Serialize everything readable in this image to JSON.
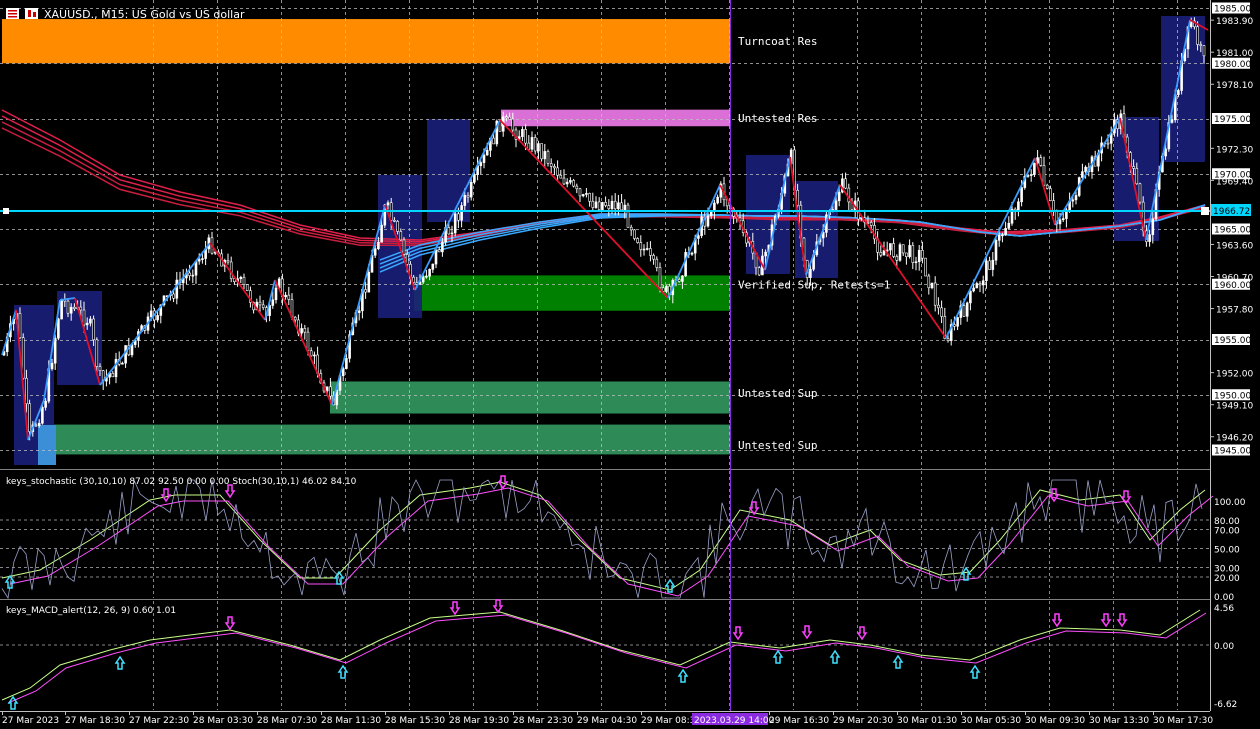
{
  "window": {
    "title": "XAUUSD., M15:  US Gold vs US dollar",
    "colors": {
      "background": "#000000",
      "grid": "#bfbfbf",
      "axis_label_bg": "#ffffff",
      "text": "#ffffff"
    }
  },
  "zones": [
    {
      "label": "Turncoat Res",
      "color": "#ff8c00",
      "y_top": 1984.0,
      "y_bottom": 1980.0
    },
    {
      "label": "Untested Res",
      "color": "#da70d6",
      "y_top": 1975.8,
      "y_bottom": 1974.3
    },
    {
      "label": "Verified Sup, Retests=1",
      "color": "#008000",
      "y_top": 1960.8,
      "y_bottom": 1957.6
    },
    {
      "label": "Untested Sup",
      "color": "#2e8b57",
      "y_top": 1951.2,
      "y_bottom": 1948.3
    },
    {
      "label": "Untested Sup",
      "color": "#2e8b57",
      "y_top": 1947.3,
      "y_bottom": 1944.6
    }
  ],
  "price_axis": {
    "ticks": [
      "1983.90",
      "1981.00",
      "1978.10",
      "1972.30",
      "1969.40",
      "1963.60",
      "1960.70",
      "1957.80",
      "1952.00",
      "1949.10",
      "1946.20"
    ],
    "highlight_ticks": [
      "1985.00",
      "1980.00",
      "1975.00",
      "1970.00",
      "1965.00",
      "1960.00",
      "1955.00",
      "1950.00",
      "1945.00"
    ],
    "current_price": "1966.72",
    "current_price_color": "#00d7ff",
    "last_price": "1980.00"
  },
  "stochastic": {
    "title": "keys_stochastic (30,10,10) 87.02 92.50 0.00 0.00 Stoch(30,10,1) 46.02 84.10",
    "levels": [
      "100.00",
      "80.00",
      "70.00",
      "50.00",
      "30.00",
      "20.00",
      "0.00"
    ]
  },
  "macd": {
    "title": "keys_MACD_alert(12, 26, 9) 0.60 1.01",
    "levels": [
      "4.56",
      "0.00",
      "-6.62"
    ]
  },
  "time_axis": {
    "labels": [
      "27 Mar 2023",
      "27 Mar 18:30",
      "27 Mar 22:30",
      "28 Mar 03:30",
      "28 Mar 07:30",
      "28 Mar 11:30",
      "28 Mar 15:30",
      "28 Mar 19:30",
      "28 Mar 23:30",
      "29 Mar 04:30",
      "29 Mar 08:3",
      "29 Mar 16:30",
      "29 Mar 20:30",
      "30 Mar 01:30",
      "30 Mar 05:30",
      "30 Mar 09:30",
      "30 Mar 13:30",
      "30 Mar 17:30"
    ],
    "crosshair_label": "2023.03.29 14:00",
    "crosshair_color": "#8a2be2"
  }
}
